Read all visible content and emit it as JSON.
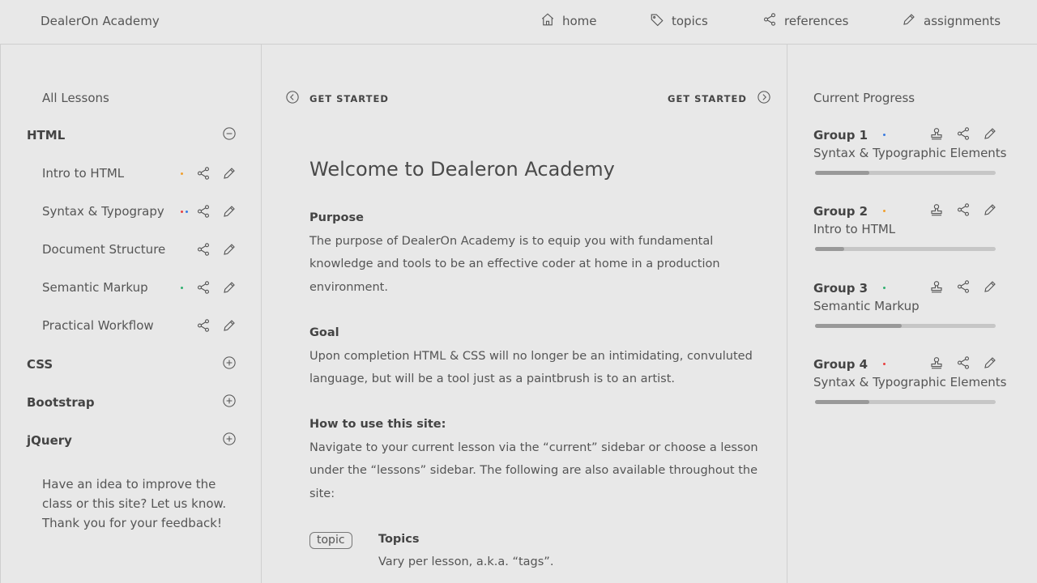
{
  "app": {
    "brand": "DealerOn Academy"
  },
  "nav": {
    "home": "home",
    "topics": "topics",
    "references": "references",
    "assignments": "assignments"
  },
  "sidebar": {
    "title": "All Lessons",
    "groups": [
      {
        "label": "HTML",
        "expanded": true,
        "icon": "minus-circle-icon",
        "lessons": [
          {
            "label": "Intro to HTML",
            "dots": [
              "#f0a030"
            ]
          },
          {
            "label": "Syntax & Typograpy",
            "dots": [
              "#e84040",
              "#3a7be0"
            ]
          },
          {
            "label": "Document Structure",
            "dots": []
          },
          {
            "label": "Semantic Markup",
            "dots": [
              "#30b070"
            ]
          },
          {
            "label": "Practical Workflow",
            "dots": []
          }
        ]
      },
      {
        "label": "CSS",
        "expanded": false,
        "icon": "plus-circle-icon"
      },
      {
        "label": "Bootstrap",
        "expanded": false,
        "icon": "plus-circle-icon"
      },
      {
        "label": "jQuery",
        "expanded": false,
        "icon": "plus-circle-icon"
      }
    ],
    "feedback": "Have an idea to improve the class or this site? Let us know. Thank you for your feedback!"
  },
  "main": {
    "prev": "GET STARTED",
    "next": "GET STARTED",
    "title": "Welcome to Dealeron Academy",
    "purpose_h": "Purpose",
    "purpose_p": "The purpose of DealerOn Academy is to equip you with fundamental knowledge and tools to be an effective coder at home in a production environment.",
    "goal_h": "Goal",
    "goal_p": "Upon completion HTML & CSS will no longer be an intimidating, convuluted language, but will be a tool just as a paintbrush is to an artist.",
    "howto_h": "How to use this site:",
    "howto_p": "Navigate to your current lesson via the “current” sidebar or choose a lesson under the “lessons” sidebar. The following are also available throughout the site:",
    "topic_chip": "topic",
    "topic_h": "Topics",
    "topic_p": "Vary per lesson, a.k.a. “tags”."
  },
  "progress": {
    "title": "Current Progress",
    "groups": [
      {
        "name": "Group 1",
        "lesson": "Syntax & Typographic Elements",
        "dot": "#3a7be0",
        "progress": 0.3
      },
      {
        "name": "Group 2",
        "lesson": "Intro to HTML",
        "dot": "#f0a030",
        "progress": 0.16
      },
      {
        "name": "Group 3",
        "lesson": "Semantic Markup",
        "dot": "#30b070",
        "progress": 0.48
      },
      {
        "name": "Group 4",
        "lesson": "Syntax & Typographic Elements",
        "dot": "#e84040",
        "progress": 0.3
      }
    ]
  }
}
